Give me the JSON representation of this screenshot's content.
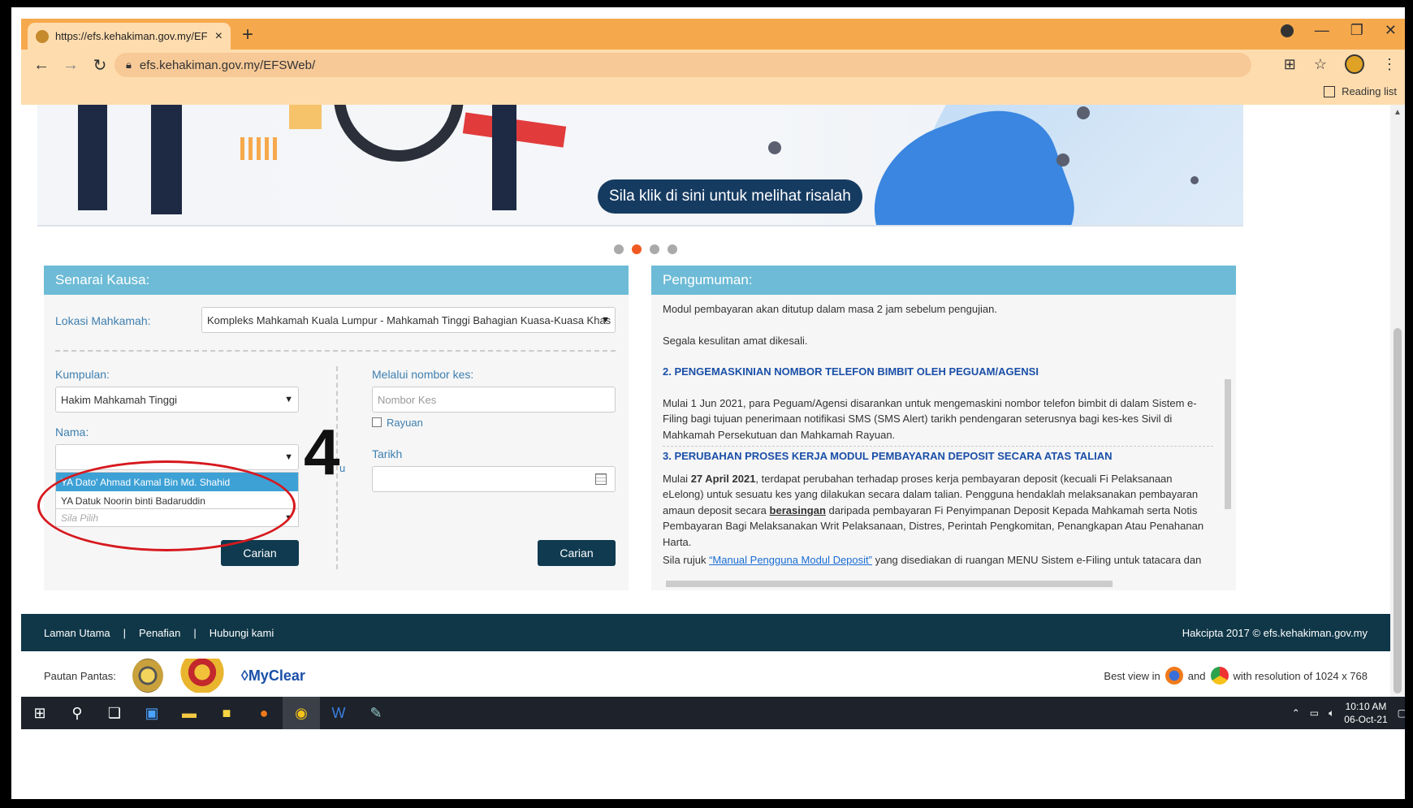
{
  "browser": {
    "tab_title": "https://efs.kehakiman.gov.my/EF",
    "tab_close": "×",
    "new_tab": "+",
    "url": "efs.kehakiman.gov.my/EFSWeb/",
    "reading_list": "Reading list"
  },
  "banner": {
    "button_text": "Sila klik di sini untuk melihat risalah"
  },
  "senarai": {
    "title": "Senarai Kausa:",
    "lokasi_label": "Lokasi Mahkamah:",
    "lokasi_value": "Kompleks Mahkamah Kuala Lumpur - Mahkamah Tinggi Bahagian Kuasa-Kuasa Khas",
    "kumpulan_label": "Kumpulan:",
    "kumpulan_value": "Hakim Mahkamah Tinggi",
    "nama_label": "Nama:",
    "nama_options": [
      "YA Dato' Ahmad Kamal Bin Md. Shahid",
      "YA Datuk Noorin binti Badaruddin"
    ],
    "sila_pilih": "Sila Pilih",
    "nombor_label": "Melalui nombor kes:",
    "nombor_placeholder": "Nombor Kes",
    "rayuan_label": "Rayuan",
    "tarikh_label": "Tarikh",
    "carian": "Carian",
    "atau_fragment": "u",
    "annotation_number": "4"
  },
  "pengumuman": {
    "title": "Pengumuman:",
    "line1": "Modul pembayaran akan ditutup dalam masa 2 jam sebelum pengujian.",
    "line2": "Segala kesulitan amat dikesali.",
    "h2": "2. PENGEMASKINIAN NOMBOR TELEFON BIMBIT OLEH PEGUAM/AGENSI",
    "p2": "Mulai 1 Jun 2021, para Peguam/Agensi disarankan untuk mengemaskini nombor telefon bimbit di dalam Sistem e-Filing bagi tujuan penerimaan notifikasi SMS (SMS Alert) tarikh pendengaran seterusnya bagi kes-kes Sivil di Mahkamah Persekutuan dan Mahkamah Rayuan.",
    "h3": "3. PERUBAHAN PROSES KERJA MODUL PEMBAYARAN DEPOSIT SECARA ATAS TALIAN",
    "p3_a": "Mulai ",
    "p3_date": "27 April 2021",
    "p3_b": ", terdapat perubahan terhadap proses kerja pembayaran deposit (kecuali Fi Pelaksanaan eLelong) untuk sesuatu kes yang dilakukan secara dalam talian. Pengguna hendaklah melaksanakan pembayaran amaun deposit secara ",
    "p3_bold": "berasingan",
    "p3_c": " daripada pembayaran Fi Penyimpanan Deposit Kepada Mahkamah serta Notis Pembayaran Bagi Melaksanakan Writ Pelaksanaan, Distres, Perintah Pengkomitan, Penangkapan Atau Penahanan Harta.",
    "p4_a": "Sila rujuk ",
    "p4_link": "“Manual Pengguna Modul Deposit”",
    "p4_b": " yang disediakan di ruangan MENU Sistem e-Filing untuk tatacara dan"
  },
  "footer": {
    "links": [
      "Laman Utama",
      "Penafian",
      "Hubungi kami"
    ],
    "separator": "|",
    "copyright": "Hakcipta 2017 © efs.kehakiman.gov.my",
    "pautan": "Pautan Pantas:",
    "myclear": "MyClear",
    "best_view": "Best view in",
    "and": "and",
    "resolution": "with resolution of 1024 x 768"
  },
  "taskbar": {
    "time": "10:10 AM",
    "date": "06-Oct-21"
  },
  "colors": {
    "tabbar": "#f6a94c",
    "panel_header": "#6dbbd6",
    "button": "#0f3a50",
    "footer": "#0f3748",
    "active_dot": "#f05a22"
  }
}
